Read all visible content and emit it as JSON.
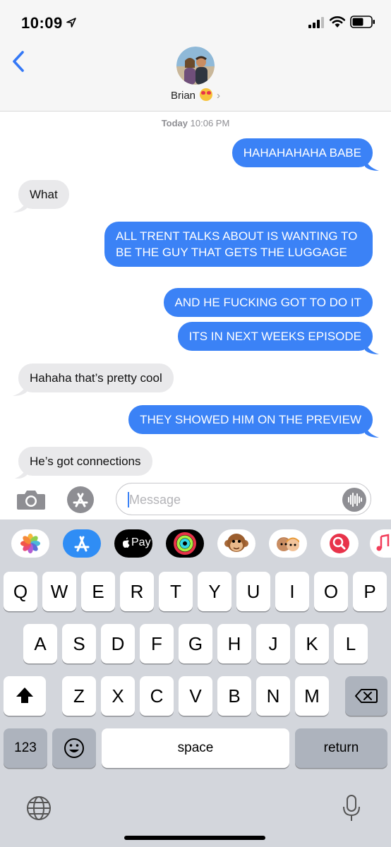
{
  "status_bar": {
    "time": "10:09"
  },
  "header": {
    "contact_name": "Brian",
    "back_label": "back"
  },
  "thread": {
    "timestamp_day": "Today",
    "timestamp_time": "10:06 PM",
    "messages": [
      {
        "from": "me",
        "text": "HAHAHAHAHA BABE"
      },
      {
        "from": "them",
        "text": "What"
      },
      {
        "from": "me",
        "text": "ALL TRENT TALKS ABOUT IS WANTING TO BE THE GUY THAT GETS THE LUGGAGE"
      },
      {
        "from": "me",
        "text": "AND HE FUCKING GOT TO DO IT"
      },
      {
        "from": "me",
        "text": "ITS IN NEXT WEEKS EPISODE"
      },
      {
        "from": "them",
        "text": "Hahaha that’s pretty cool"
      },
      {
        "from": "me",
        "text": "THEY SHOWED HIM ON THE PREVIEW"
      },
      {
        "from": "them",
        "text": "He’s got connections"
      }
    ]
  },
  "input": {
    "placeholder": "Message"
  },
  "app_drawer": {
    "items": [
      "photos-app",
      "app-store-app",
      "apple-pay-app",
      "activity-app",
      "monkey-animoji",
      "memoji-stickers",
      "search-images-app",
      "music-app"
    ],
    "apple_pay_label": "Pay"
  },
  "keyboard": {
    "row1": [
      "Q",
      "W",
      "E",
      "R",
      "T",
      "Y",
      "U",
      "I",
      "O",
      "P"
    ],
    "row2": [
      "A",
      "S",
      "D",
      "F",
      "G",
      "H",
      "J",
      "K",
      "L"
    ],
    "row3": [
      "Z",
      "X",
      "C",
      "V",
      "B",
      "N",
      "M"
    ],
    "numbers_key": "123",
    "space_key": "space",
    "return_key": "return"
  },
  "colors": {
    "outgoing_bubble": "#3b82f6",
    "incoming_bubble": "#e9e9eb",
    "keyboard_bg": "#d3d6dc"
  }
}
